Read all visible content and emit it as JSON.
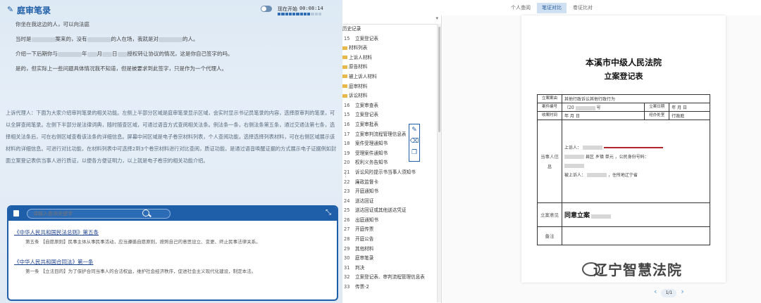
{
  "left": {
    "title": "庭审笔录",
    "toggle_label": "现在开始",
    "timer": "00:08:14",
    "progress_segments": 12,
    "progress_filled": 9,
    "paragraph1": "你坐在我这边的人，可以向法庭",
    "p2_a": "当时是",
    "p2_b": "案来的，没有",
    "p2_c": "的人在场，我就是对",
    "p2_d": "的人。",
    "p3_a": "介绍一下后期你与",
    "p3_b": "年",
    "p3_c": "月",
    "p3_d": "日",
    "p3_e": "授权转让协议的情况，这是你自己签字的吗。",
    "p4": "是的，但实际上一些问题具体情况我不知道，但是被要求到此签字，只是作为一个代理人。",
    "description": "上诉代理人：下面为大家介绍审判笔录的相关功能。左侧上半部分区域是庭审笔录显示区域，会实时显示书记员笔录的内容，选择原审判的笔录，可以全屏查阅笔录。左侧下半部分是法律词典，随时随查区域，可通过语音方式查阅相关法条。例法条一条，右侧法条第五条，通过交通法第七条，选择相关法条后，可在右侧区域查看该法条的详细信息。屏幕中间区域是电子卷宗材料列表，个人查阅功能，选择选择列表材料，可在右侧区域展示该材料的详细信息。可进行对比功能，在材料列表中可选择2到3个卷宗材料进行对比查阅，质证功能，是通过语音唤醒证据的方式展示电子证据例如封面立案登记表供当事人进行质证，以便各方便证明力，以上就是电子卷宗的相关功能介绍。",
    "search_placeholder": "请输入查询关键字",
    "laws": [
      {
        "title": "《中华人民共和国民法总则》第五条",
        "text": "第五条 【自愿原则】民事主体从事民事活动，应当遵循自愿原则，按照自己的意思设立、变更、终止民事法律关系。"
      },
      {
        "title": "《中华人民共和国合同法》第一条",
        "text": "第一条 【立法目的】为了保护合同当事人的合法权益，维护社会经济秩序，促进社会主义现代化建设，制定本法。"
      }
    ]
  },
  "tabs": [
    "个人查阅",
    "笔证对比",
    "卷证比对"
  ],
  "tree": {
    "header1": "历史记录",
    "rows": [
      {
        "n": "15",
        "label": "立案登记表"
      },
      {
        "n": "",
        "label": "材料列表"
      },
      {
        "n": "",
        "label": "上诉人材料"
      },
      {
        "n": "",
        "label": "原告材料"
      },
      {
        "n": "",
        "label": "被上诉人材料"
      },
      {
        "n": "",
        "label": "庭审材料"
      },
      {
        "n": "",
        "label": "诉讼材料"
      },
      {
        "n": "16",
        "label": "立案审查表"
      },
      {
        "n": "15",
        "label": "立案登记表"
      },
      {
        "n": "16",
        "label": "立案审批表"
      },
      {
        "n": "17",
        "label": "立案审判流程管理信息表"
      },
      {
        "n": "18",
        "label": "案件受理通知书"
      },
      {
        "n": "19",
        "label": "受理案件通知书"
      },
      {
        "n": "20",
        "label": "权利义务告知书"
      },
      {
        "n": "21",
        "label": "诉讼风险提示书当事人须知书"
      },
      {
        "n": "22",
        "label": "廉政监督卡"
      },
      {
        "n": "23",
        "label": "开庭通知书"
      },
      {
        "n": "24",
        "label": "送达回证"
      },
      {
        "n": "25",
        "label": "送达回证或其他送达凭证"
      },
      {
        "n": "26",
        "label": "出庭通知书"
      },
      {
        "n": "27",
        "label": "开庭传票"
      },
      {
        "n": "28",
        "label": "开庭公告"
      },
      {
        "n": "29",
        "label": "其他材料"
      },
      {
        "n": "30",
        "label": "庭审笔录"
      },
      {
        "n": "31",
        "label": "判决"
      },
      {
        "n": "32",
        "label": "立案登记表、审判流程管理信息表"
      },
      {
        "n": "33",
        "label": "传票-2"
      }
    ]
  },
  "doc": {
    "title1": "本溪市中级人民法院",
    "title2": "立案登记表",
    "row_case_label": "立案案由",
    "row_case_value": "其他行政诉讼其他行政行为",
    "row_no_label": "案件编号",
    "row_no_value": "（20",
    "row_no_suffix": "号",
    "row_filed_label": "立案日期",
    "row_filed_date": "年  月  日",
    "row_intake_label": "收案时间",
    "row_intake_date": "年  月  日",
    "row_org_label": "经办处室",
    "row_org_value": "行政庭",
    "party_label": "当事人信息",
    "party_line1": "上诉人：",
    "party_line2": "县区    乡镇    单元    ，公民身份号码：",
    "party_line3": "被上诉人：",
    "party_line4": "，住所地辽宁省",
    "opinion_label": "立案意见",
    "opinion_value": "同意立案",
    "remark_label": "备注",
    "page": "1/1"
  },
  "watermark": "辽宁智慧法院"
}
